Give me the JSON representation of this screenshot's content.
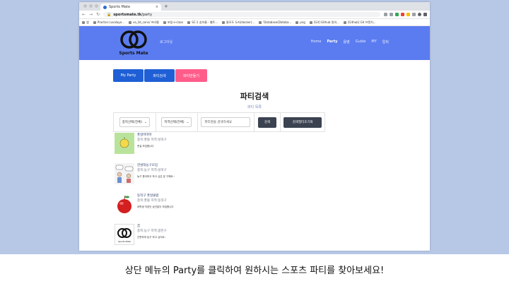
{
  "browser": {
    "tab_title": "Sports Mate",
    "tab_close": "×",
    "new_tab": "+",
    "url_domain": "sportsmate.tk",
    "url_path": "/party",
    "bookmarks": [
      "앱",
      "Practice (uvalayo...",
      "va_lid_conv/ 프라윌",
      "포털 e-class",
      "SC-1 송하율 - 웹트...",
      "물모두 도커(docker)...",
      "'Database(Databa...",
      "png",
      "[Git] Github 원의...",
      "[Github] Git 브랜치..."
    ]
  },
  "header": {
    "logo_text": "Sports Mate",
    "login": "로그아웃",
    "nav": [
      {
        "label": "Home",
        "active": false
      },
      {
        "label": "Party",
        "active": true
      },
      {
        "label": "용병",
        "active": false
      },
      {
        "label": "Guide",
        "active": false
      },
      {
        "label": "MY",
        "active": false
      },
      {
        "label": "탈퇴",
        "active": false
      }
    ]
  },
  "buttons": {
    "my_party": "My Party",
    "party_search": "파티검색",
    "party_create": "파티만들기"
  },
  "page": {
    "title": "파티검색",
    "subtitle": "파티 목록"
  },
  "search": {
    "sport_select": "종목선택(전체)",
    "region_select": "지역선택(전체)",
    "keyword_placeholder": "파티명을 검색하세요",
    "search_button": "검색",
    "reset_button": "검색필터초기화"
  },
  "parties": [
    {
      "name": "풋살마마마",
      "meta": "종목:풋볼 지역:성북구",
      "desc": "풋살 모임합니다"
    },
    {
      "name": "한성대농구모임",
      "meta": "종목:농구 지역:성북구",
      "desc": "농구 좋아하고 하고 싶은 분 구해요~"
    },
    {
      "name": "동작구 풋살클럽",
      "meta": "종목:풋볼 지역:동작구",
      "desc": "대학생 직장인 상관없이 모집합니다"
    },
    {
      "name": "꿈",
      "meta": "종목:농구 지역:광진구",
      "desc": "간편하게 농구 하고 싶어요..",
      "thumb_text": "Sports Mate"
    }
  ],
  "caption": "상단 메뉴의 Party를 클릭하여 원하시는 스포츠 파티를 찾아보세요!",
  "colors": {
    "header": "#5b7cf0",
    "button_blue": "#1f5fd6",
    "button_pink": "#ff5c8a",
    "dark_button": "#3b4250",
    "background": "#b7c7e6"
  }
}
